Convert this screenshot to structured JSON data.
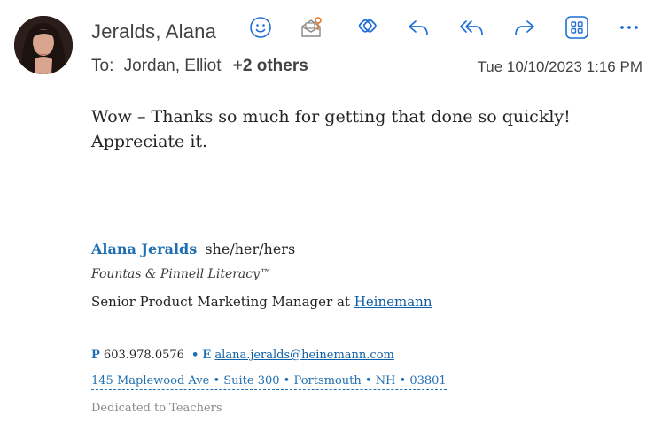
{
  "header": {
    "sender": "Jeralds, Alana",
    "to_label": "To:",
    "recipients": "Jordan, Elliot",
    "others": "+2 others",
    "timestamp": "Tue 10/10/2023 1:16 PM"
  },
  "toolbar": {
    "icons": [
      "emoji-icon",
      "open-message-icon",
      "loop-icon",
      "reply-icon",
      "reply-all-icon",
      "forward-icon",
      "apps-icon",
      "more-icon"
    ],
    "accent": "#1f6fd6"
  },
  "message": {
    "body": "Wow – Thanks so much for getting that done so quickly! Appreciate it."
  },
  "signature": {
    "name": "Alana Jeralds",
    "pronouns": "she/her/hers",
    "org": "Fountas & Pinnell Literacy™",
    "title_prefix": "Senior Product Marketing Manager at ",
    "company": "Heinemann",
    "phone_label": "P",
    "phone": "603.978.0576",
    "bullet": "•",
    "email_label": "E",
    "email": "alana.jeralds@heinemann.com",
    "address": "145 Maplewood Ave • Suite 300 • Portsmouth • NH • 03801",
    "tagline": "Dedicated to Teachers",
    "accent": "#1f6fb2"
  }
}
